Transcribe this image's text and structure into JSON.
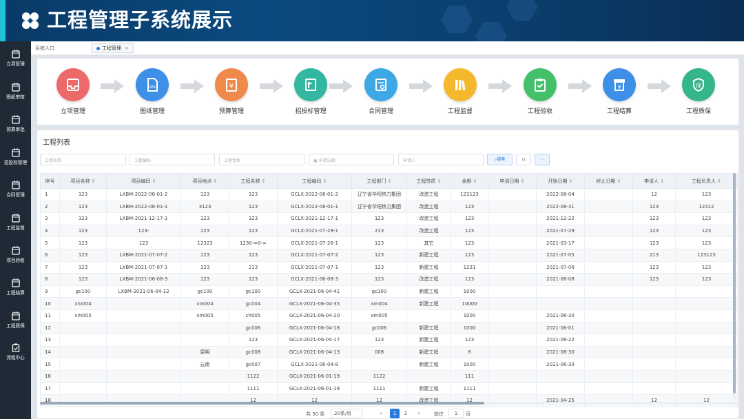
{
  "banner": {
    "title": "工程管理子系统展示"
  },
  "sidebar": {
    "items": [
      {
        "label": "立项管理"
      },
      {
        "label": "图纸审核"
      },
      {
        "label": "预算审批"
      },
      {
        "label": "招投标管理"
      },
      {
        "label": "合同管理"
      },
      {
        "label": "工程监督"
      },
      {
        "label": "项目验收"
      },
      {
        "label": "工程结算"
      },
      {
        "label": "工程质保"
      },
      {
        "label": "流程中心"
      }
    ]
  },
  "tabbar": {
    "crumb": "系统入口",
    "tab": "工程管理",
    "close": "×"
  },
  "flow": {
    "steps": [
      {
        "label": "立项管理",
        "color": "#ec6a6a"
      },
      {
        "label": "图纸管理",
        "color": "#3d8fe8"
      },
      {
        "label": "预算管理",
        "color": "#f08a4b"
      },
      {
        "label": "招投标管理",
        "color": "#33b7a0"
      },
      {
        "label": "合同管理",
        "color": "#3ea7e6"
      },
      {
        "label": "工程监督",
        "color": "#f5b72c"
      },
      {
        "label": "工程验收",
        "color": "#44c06a"
      },
      {
        "label": "工程结算",
        "color": "#3d8fe8"
      },
      {
        "label": "工程质保",
        "color": "#34b58a"
      }
    ]
  },
  "list": {
    "title": "工程列表",
    "filters": {
      "name": "工程名称",
      "code": "工程编码",
      "nature": "工程性质",
      "date": "申请日期",
      "applicant": "申请人",
      "search": "搜索"
    },
    "columns": [
      "序号",
      "项目名称",
      "项目编码",
      "项目地点",
      "工程名称",
      "工程编码",
      "工程部门",
      "工程性质",
      "金额",
      "申请日期",
      "开始日期",
      "终止日期",
      "申请人",
      "工程负责人"
    ],
    "rows": [
      [
        "1",
        "123",
        "LXBM-2022-08-01-2",
        "123",
        "123",
        "GCLX-2022-08-01-2",
        "辽宁省华阳热力集团",
        "改造工程",
        "123123",
        "",
        "2022-08-04",
        "",
        "12",
        "123"
      ],
      [
        "2",
        "123",
        "LXBM-2022-08-01-1",
        "3123",
        "123",
        "GCLX-2022-08-01-1",
        "辽宁省华阳热力集团",
        "改造工程",
        "123",
        "",
        "2022-08-31",
        "",
        "123",
        "12312"
      ],
      [
        "3",
        "123",
        "LXBM-2021-12-17-1",
        "123",
        "123",
        "GCLX-2021-12-17-1",
        "123",
        "改造工程",
        "123",
        "",
        "2021-12-22",
        "",
        "123",
        "123"
      ],
      [
        "4",
        "123",
        "123-",
        "123",
        "123",
        "GCLX-2021-07-29-1",
        "213",
        "改造工程",
        "123",
        "",
        "2021-07-29",
        "",
        "123",
        "123"
      ],
      [
        "5",
        "123",
        "123",
        "12323",
        "1230-=0-=",
        "GCLX-2021-07-26-1",
        "123",
        "其它",
        "123",
        "",
        "2021-03-17",
        "",
        "123",
        "123"
      ],
      [
        "6",
        "123",
        "LXBM-2021-07-07-2",
        "123",
        "123",
        "GCLX-2021-07-07-2",
        "123",
        "新建工程",
        "123",
        "",
        "2021-07-05",
        "",
        "213",
        "123123"
      ],
      [
        "7",
        "123",
        "LXBM-2021-07-07-1",
        "123",
        "213",
        "GCLX-2021-07-07-1",
        "123",
        "新建工程",
        "1231",
        "",
        "2021-07-06",
        "",
        "123",
        "123"
      ],
      [
        "8",
        "123",
        "LXBM-2021-06-08-3",
        "123",
        "123",
        "GCLX-2021-06-08-3",
        "123",
        "改造工程",
        "123",
        "",
        "2021-06-08",
        "",
        "123",
        "123"
      ],
      [
        "9",
        "gc100",
        "LXBM-2021-06-04-12",
        "gc100",
        "gc100",
        "GCLX-2021-06-04-41",
        "gc100",
        "新建工程",
        "1000",
        "",
        "",
        "",
        "",
        ""
      ],
      [
        "10",
        "xm004",
        "",
        "xm004",
        "gc004",
        "GCLX-2021-06-04-35",
        "xm004",
        "新建工程",
        "10000",
        "",
        "",
        "",
        "",
        ""
      ],
      [
        "11",
        "xm005",
        "",
        "xm005",
        "ch005",
        "GCLX-2021-06-04-20",
        "xm005",
        "",
        "1000",
        "",
        "2021-06-30",
        "",
        "",
        ""
      ],
      [
        "12",
        "",
        "",
        "",
        "gc006",
        "GCLX-2021-06-04-18",
        "gc006",
        "新建工程",
        "1000",
        "",
        "2021-06-01",
        "",
        "",
        ""
      ],
      [
        "13",
        "",
        "",
        "",
        "123",
        "GCLX-2021-06-04-17",
        "123",
        "新建工程",
        "123",
        "",
        "2021-06-22",
        "",
        "",
        ""
      ],
      [
        "14",
        "",
        "",
        "昆明",
        "gc008",
        "GCLX-2021-06-04-13",
        "008",
        "新建工程",
        "8",
        "",
        "2021-06-30",
        "",
        "",
        ""
      ],
      [
        "15",
        "",
        "",
        "云南",
        "gc007",
        "GCLX-2021-06-04-8",
        "",
        "新建工程",
        "1000",
        "",
        "2021-06-30",
        "",
        "",
        ""
      ],
      [
        "16",
        "",
        "",
        "",
        "1122",
        "GCLX-2021-06-01-19",
        "1122",
        "",
        "111",
        "",
        "",
        "",
        "",
        ""
      ],
      [
        "17",
        "",
        "",
        "",
        "1111",
        "GCLX-2021-06-01-18",
        "1111",
        "新建工程",
        "1111",
        "",
        "",
        "",
        "",
        ""
      ],
      [
        "18",
        "",
        "",
        "",
        "12",
        "12",
        "12",
        "改造工程",
        "12",
        "",
        "2021-04-25",
        "",
        "12",
        "12"
      ]
    ]
  },
  "pager": {
    "total": "共 50 条",
    "size": "20条/页",
    "prev": "‹",
    "p1": "1",
    "p2": "2",
    "next": "›",
    "goto": "前往",
    "jump": "1",
    "page": "页"
  }
}
